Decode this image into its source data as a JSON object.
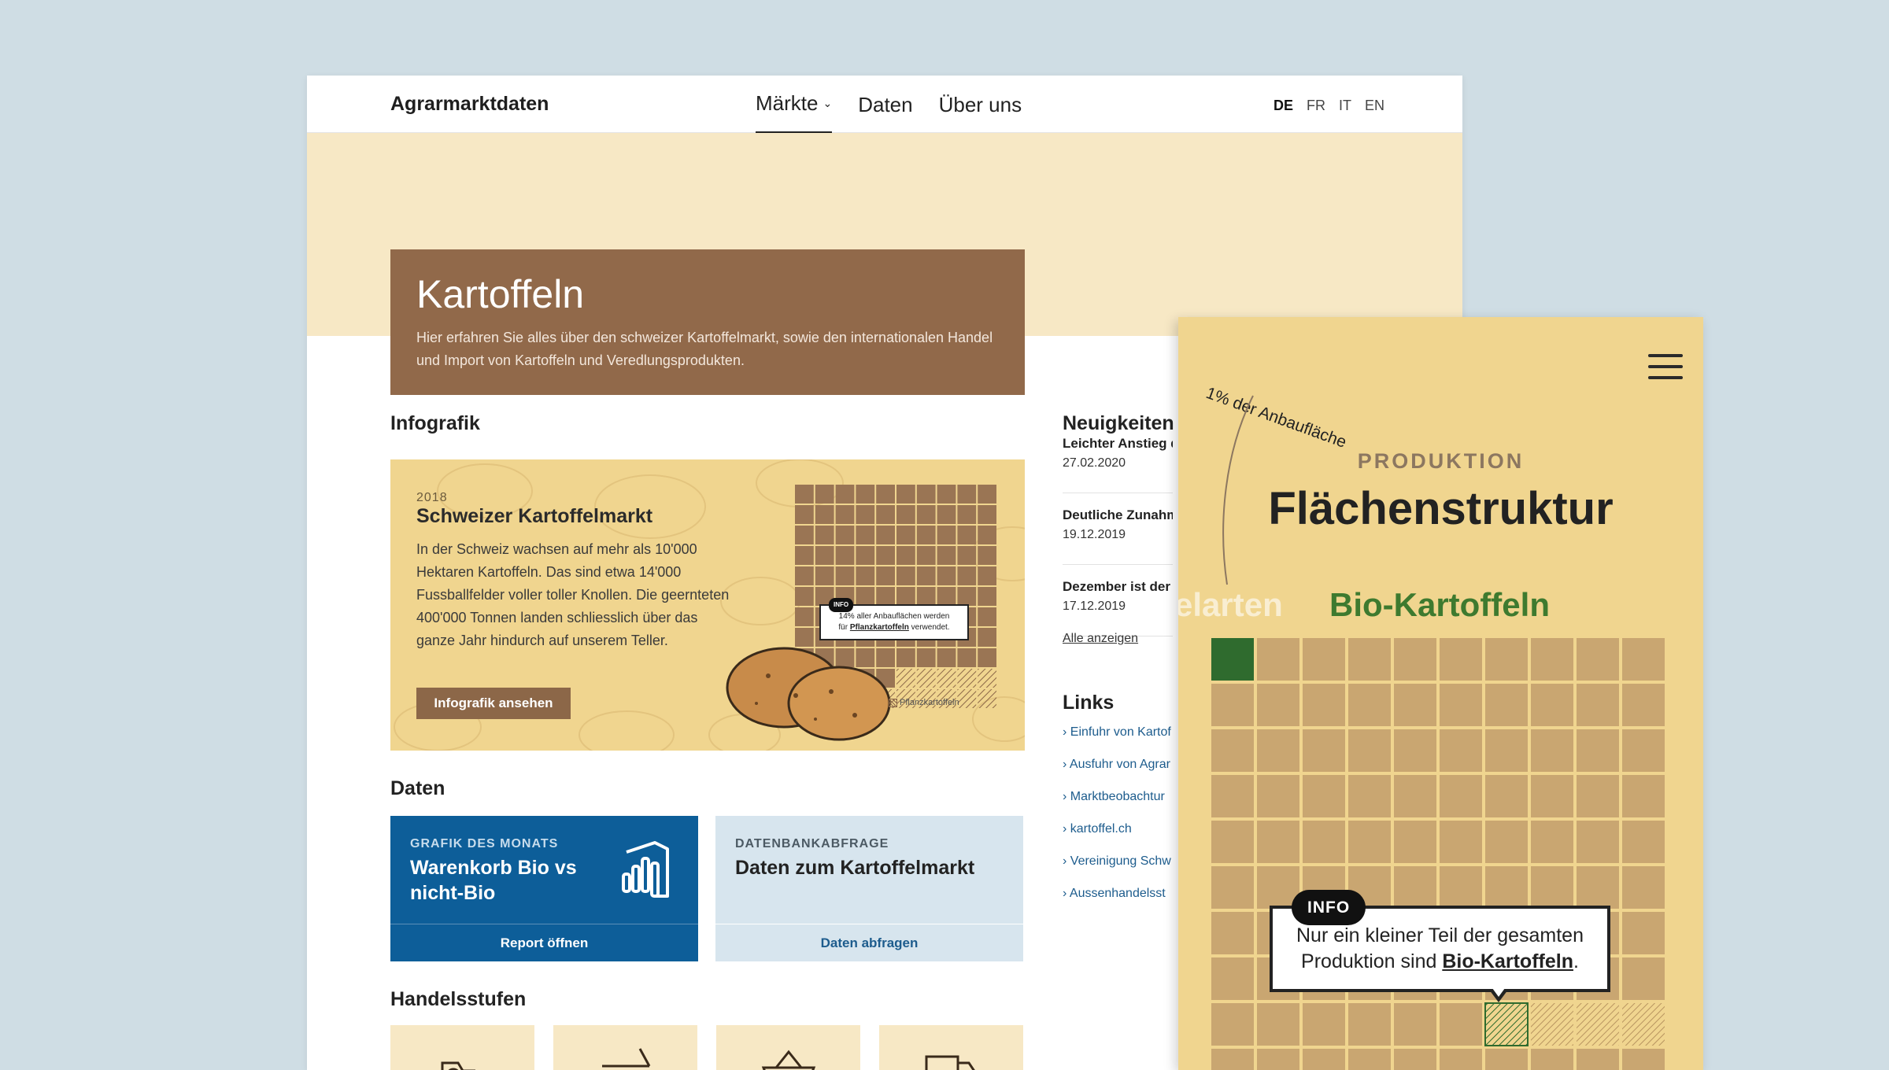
{
  "site": {
    "brand": "Agrarmarktdaten",
    "nav": [
      {
        "label": "Märkte",
        "active": true
      },
      {
        "label": "Daten",
        "active": false
      },
      {
        "label": "Über uns",
        "active": false
      }
    ],
    "languages": [
      {
        "label": "DE",
        "active": true
      },
      {
        "label": "FR",
        "active": false
      },
      {
        "label": "IT",
        "active": false
      },
      {
        "label": "EN",
        "active": false
      }
    ]
  },
  "hero": {
    "title": "Kartoffeln",
    "text": "Hier erfahren Sie alles über den schweizer Kartoffelmarkt, sowie den internationalen Handel und Import von Kartoffeln und Veredlungsprodukten."
  },
  "infografik": {
    "section_title": "Infografik",
    "year": "2018",
    "title": "Schweizer Kartoffelmarkt",
    "text": "In der Schweiz wachsen auf mehr als 10'000 Hektaren Kartoffeln. Das sind etwa 14'000 Fussballfelder voller toller Knollen. Die geernteten 400'000 Tonnen landen schliesslich über das ganze Jahr hindurch auf unserem Teller.",
    "button": "Infografik ansehen",
    "callout_tag": "INFO",
    "callout_line1": "14% aller Anbauflächen werden",
    "callout_line2_pre": "für ",
    "callout_line2_em": "Pflanzkartoffeln",
    "callout_line2_post": " verwendet.",
    "legend": "Pflanzkartoffeln",
    "highlight_share": 0.14
  },
  "daten": {
    "section_title": "Daten",
    "cards": [
      {
        "kicker": "GRAFIK DES MONATS",
        "title": "Warenkorb Bio vs nicht-Bio",
        "action": "Report öffnen",
        "icon": "powerbi-icon"
      },
      {
        "kicker": "DATENBANKABFRAGE",
        "title": "Daten zum Kartoffelmarkt",
        "action": "Daten abfragen"
      }
    ]
  },
  "handelsstufen": {
    "section_title": "Handelsstufen",
    "icons": [
      "tractor-icon",
      "arrow-icon",
      "basket-icon",
      "truck-icon"
    ]
  },
  "news": {
    "section_title": "Neuigkeiten",
    "items": [
      {
        "title": "Leichter Anstieg de",
        "date": "27.02.2020"
      },
      {
        "title": "Deutliche Zunahm",
        "date": "19.12.2019"
      },
      {
        "title": "Dezember ist der F",
        "date": "17.12.2019"
      }
    ],
    "all_link": "Alle anzeigen"
  },
  "links": {
    "section_title": "Links",
    "items": [
      "› Einfuhr von Kartof",
      "› Ausfuhr von Agrar",
      "› Marktbeobachtur",
      "› kartoffel.ch",
      "› Vereinigung Schw",
      "› Aussenhandelsst"
    ]
  },
  "mobile": {
    "annotation": "1% der Anbaufläche",
    "kicker": "PRODUKTION",
    "title": "Flächenstruktur",
    "tab_left": "elarten",
    "tab_right": "Bio-Kartoffeln",
    "callout_tag": "INFO",
    "callout_pre": "Nur ein kleiner Teil der gesamten Produktion sind ",
    "callout_em": "Bio-Kartoffeln",
    "callout_post": ".",
    "colors": {
      "bio": "#2f6b2e",
      "cell": "#c9a671",
      "grid_line": "#f0d58f",
      "background": "#f0d58f"
    }
  },
  "colors": {
    "brand_brown": "#91694a",
    "hero_band": "#f7e8c5",
    "blue": "#0d5e99",
    "light_blue": "#d7e5ee",
    "infographic_bg": "#f0d58f"
  }
}
